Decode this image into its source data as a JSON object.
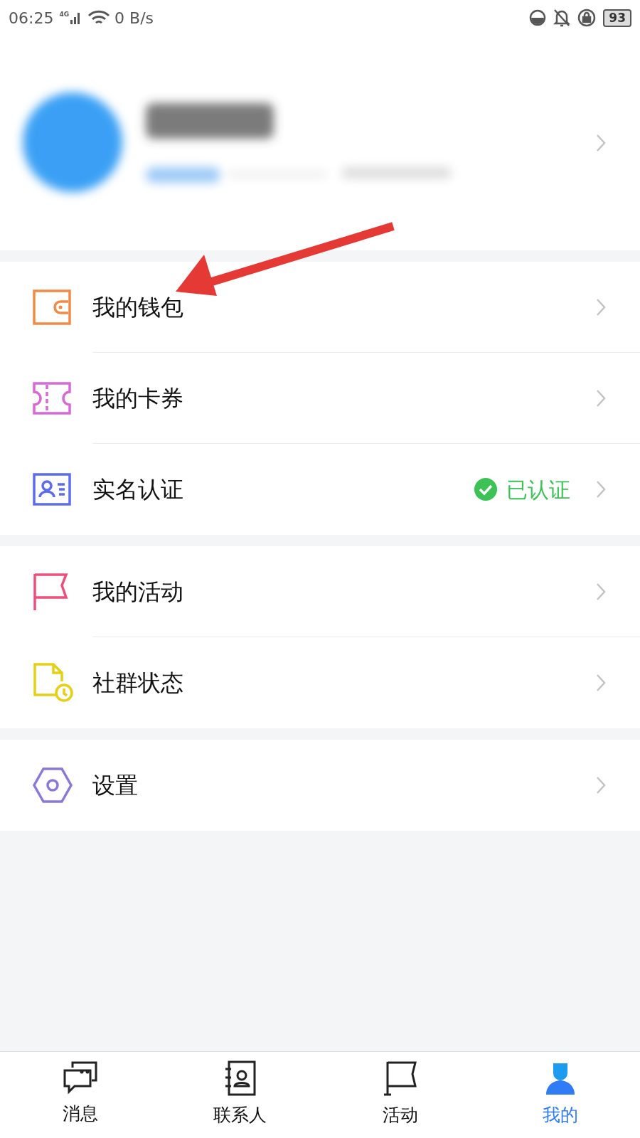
{
  "status_bar": {
    "time": "06:25",
    "network": "4G",
    "speed": "0 B/s",
    "battery": "93"
  },
  "menu_groups": [
    {
      "items": [
        {
          "kind": "wallet",
          "label": "我的钱包"
        },
        {
          "kind": "ticket",
          "label": "我的卡券"
        },
        {
          "kind": "idcard",
          "label": "实名认证",
          "status": "已认证"
        }
      ]
    },
    {
      "items": [
        {
          "kind": "flag",
          "label": "我的活动"
        },
        {
          "kind": "document",
          "label": "社群状态"
        }
      ]
    },
    {
      "items": [
        {
          "kind": "hexagon",
          "label": "设置"
        }
      ]
    }
  ],
  "tabs": [
    {
      "kind": "chat",
      "label": "消息",
      "selected": false
    },
    {
      "kind": "contacts",
      "label": "联系人",
      "selected": false
    },
    {
      "kind": "flag",
      "label": "活动",
      "selected": false
    },
    {
      "kind": "person",
      "label": "我的",
      "selected": true
    }
  ]
}
